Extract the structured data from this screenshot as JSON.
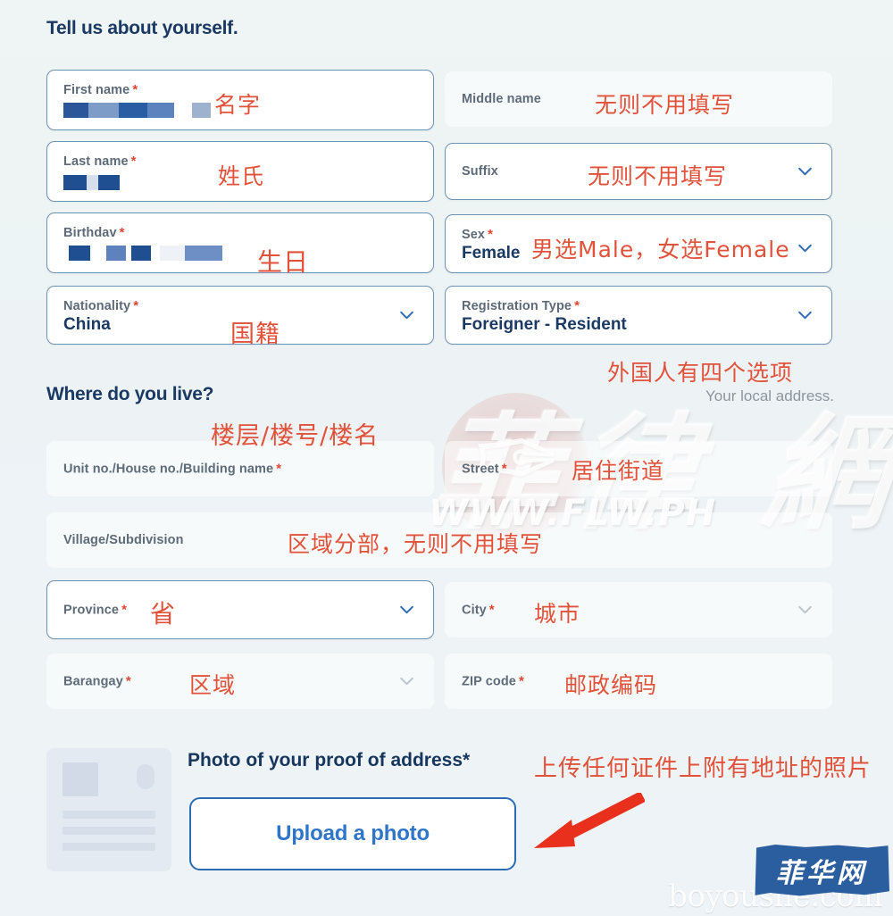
{
  "headings": {
    "about_you": "Tell us about yourself.",
    "where_you_live": "Where do you live?",
    "local_address_note": "Your local address."
  },
  "required_marker": "*",
  "fields": {
    "first_name": {
      "label": "First name",
      "required": true,
      "value": "",
      "annotation": "名字"
    },
    "middle_name": {
      "label": "Middle name",
      "required": false,
      "value": "",
      "annotation": "无则不用填写"
    },
    "last_name": {
      "label": "Last name",
      "required": true,
      "value": "",
      "annotation": "姓氏"
    },
    "suffix": {
      "label": "Suffix",
      "required": false,
      "value": "",
      "annotation": "无则不用填写"
    },
    "birthday": {
      "label": "Birthdav",
      "required": true,
      "value": "",
      "annotation": "生日"
    },
    "sex": {
      "label": "Sex",
      "required": true,
      "value": "Female",
      "annotation": "男选Male，女选Female"
    },
    "nationality": {
      "label": "Nationality",
      "required": true,
      "value": "China",
      "annotation": "国籍"
    },
    "registration_type": {
      "label": "Registration Type",
      "required": true,
      "value": "Foreigner - Resident",
      "annotation": "外国人有四个选项"
    },
    "unit_no": {
      "label": "Unit no./House no./Building name",
      "required": true,
      "value": "",
      "annotation": "楼层/楼号/楼名"
    },
    "street": {
      "label": "Street",
      "required": true,
      "value": "",
      "annotation": "居住街道"
    },
    "village": {
      "label": "Village/Subdivision",
      "required": false,
      "value": "",
      "annotation": "区域分部，无则不用填写"
    },
    "province": {
      "label": "Province",
      "required": true,
      "value": "",
      "annotation": "省"
    },
    "city": {
      "label": "City",
      "required": true,
      "value": "",
      "annotation": "城市"
    },
    "barangay": {
      "label": "Barangay",
      "required": true,
      "value": "",
      "annotation": "区域"
    },
    "zip_code": {
      "label": "ZIP code",
      "required": true,
      "value": "",
      "annotation": "邮政编码"
    }
  },
  "upload": {
    "label": "Photo of your proof of address",
    "required": true,
    "button_label": "Upload a photo",
    "annotation": "上传任何证件上附有地址的照片"
  },
  "watermark": {
    "cjk": "菲律 網",
    "url": "WWW.FLW.PH",
    "swirl": "✑"
  },
  "brand": {
    "badge_text": "菲华网",
    "site_url": "boyoushe.com"
  },
  "colors": {
    "page_background": "#eef4f5",
    "field_border_active": "#6f93b5",
    "label_text": "#5d6a78",
    "value_text": "#1b3a63",
    "required_red": "#e0452f",
    "annotation_red": "#e2523a",
    "accent_blue": "#2f76c8",
    "arrow_red": "#e8301c",
    "brand_blue": "#2b5e9e"
  }
}
